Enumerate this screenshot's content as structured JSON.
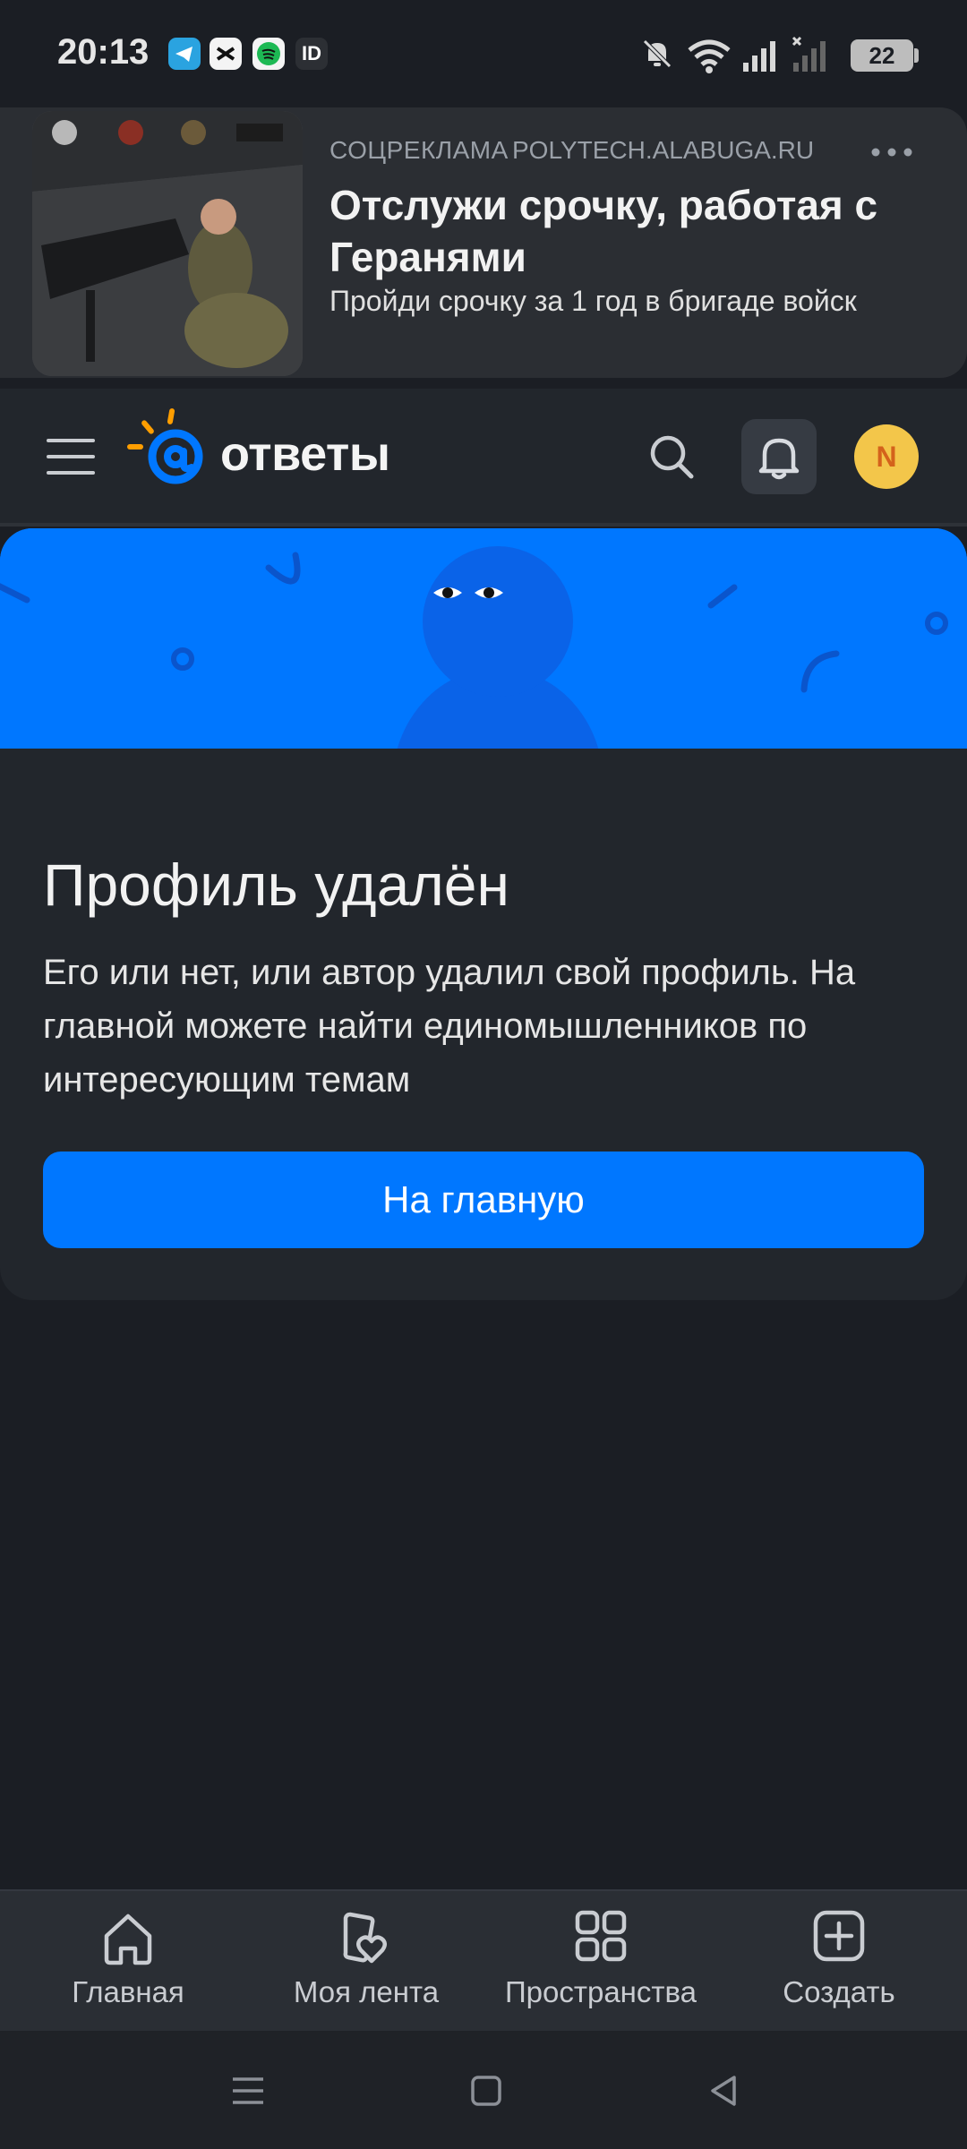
{
  "status_bar": {
    "time": "20:13",
    "notification_icons": [
      "telegram-icon",
      "capcut-icon",
      "spotify-icon",
      "id-icon"
    ],
    "id_icon_text": "ID",
    "right_icons": [
      "bell-muted-icon",
      "wifi-icon",
      "signal-icon",
      "signal-no-service-icon"
    ],
    "battery": "22"
  },
  "ad": {
    "label": "СОЦРЕКЛАМА",
    "domain": "POLYTECH.ALABUGA.RU",
    "title": "Отслужи срочку, работая с Геранями",
    "text": "Пройди срочку за 1 год в бригаде войск",
    "more_icon": "more-dots-icon"
  },
  "header": {
    "menu_icon": "hamburger-menu-icon",
    "logo_text": "ответы",
    "search_icon": "search-icon",
    "bell_icon": "bell-icon",
    "avatar_letter": "N"
  },
  "colors": {
    "accent": "#0077ff",
    "background": "#1b1e24",
    "card": "#22262c",
    "avatar": "#f3c64a",
    "logo_orange": "#ff9e00"
  },
  "main": {
    "title": "Профиль удалён",
    "description": "Его или нет, или автор удалил свой профиль. На главной можете найти единомышленников по интересующим темам",
    "button_label": "На главную"
  },
  "bottom_nav": {
    "items": [
      {
        "label": "Главная",
        "icon": "home-icon"
      },
      {
        "label": "Моя лента",
        "icon": "feed-heart-icon"
      },
      {
        "label": "Пространства",
        "icon": "grid-icon"
      },
      {
        "label": "Создать",
        "icon": "plus-square-icon"
      }
    ]
  },
  "system_nav": {
    "icons": [
      "recent-apps-icon",
      "home-square-icon",
      "back-triangle-icon"
    ]
  }
}
